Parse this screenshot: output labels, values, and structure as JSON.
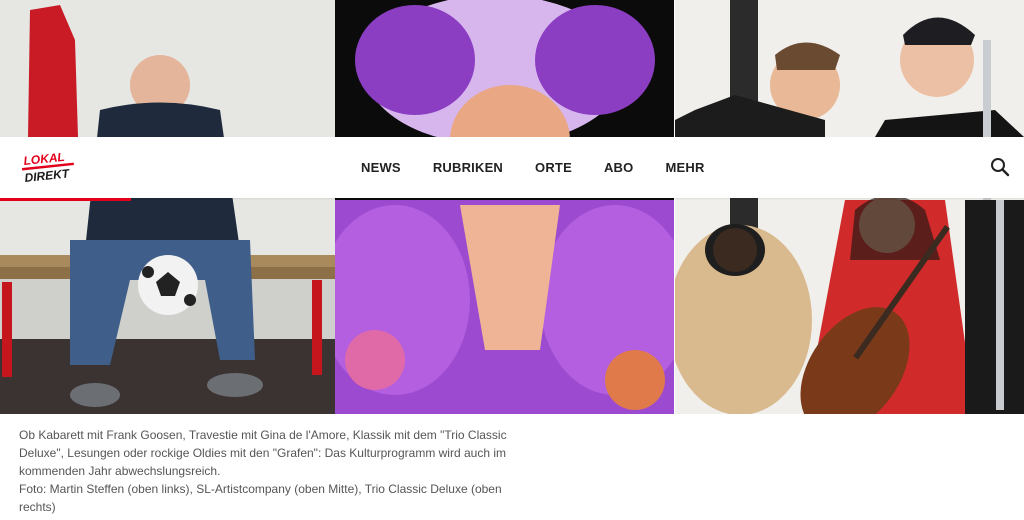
{
  "logo": {
    "line1": "LOKAL",
    "line2": "DIREKT",
    "accent": "#e3001b"
  },
  "nav": {
    "items": [
      "NEWS",
      "RUBRIKEN",
      "ORTE",
      "ABO",
      "MEHR"
    ],
    "search_icon": "search-icon"
  },
  "caption": {
    "text": "Ob Kabarett mit Frank Goosen, Travestie mit Gina de l'Amore, Klassik mit dem \"Trio Classic Deluxe\", Lesungen oder rockige Oldies mit den \"Grafen\": Das Kulturprogramm wird auch im kommenden Jahr abwechslungsreich.",
    "credit": "Foto: Martin Steffen (oben links), SL-Artistcompany (oben Mitte), Trio Classic Deluxe (oben rechts)"
  }
}
